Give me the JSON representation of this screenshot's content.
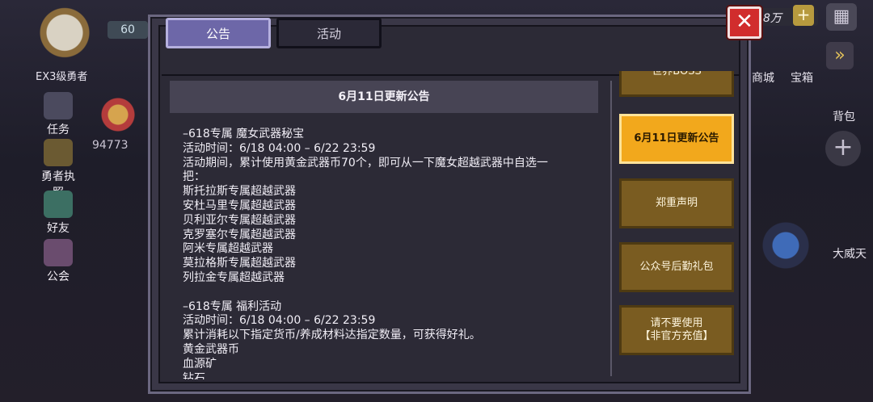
{
  "hud": {
    "level": "60",
    "rank_title": "EX3级勇者",
    "power": "94773",
    "currency": "8万",
    "side_buttons": [
      "任务",
      "勇者执照",
      "好友",
      "公会"
    ],
    "top_right_labels": [
      "商城",
      "宝箱",
      "背包"
    ],
    "boss_label": "大威天"
  },
  "dialog": {
    "tabs": [
      "公告",
      "活动"
    ],
    "active_tab_index": 0,
    "notice": {
      "title": "6月11日更新公告",
      "lines": [
        "–618专属 魔女武器秘宝",
        "活动时间：6/18 04:00 – 6/22 23:59",
        "活动期间，累计使用黄金武器币70个，即可从一下魔女超越武器中自选一",
        "把：",
        "斯托拉斯专属超越武器",
        "安杜马里专属超越武器",
        "贝利亚尔专属超越武器",
        "克罗塞尔专属超越武器",
        "阿米专属超越武器",
        "莫拉格斯专属超越武器",
        "列拉金专属超越武器",
        "",
        "–618专属 福利活动",
        "活动时间：6/18 04:00 – 6/22 23:59",
        "累计消耗以下指定货币/养成材料达指定数量，可获得好礼。",
        "黄金武器币",
        "血源矿",
        "钻石"
      ]
    },
    "side_list": [
      {
        "label": "世界BOSS",
        "active": false
      },
      {
        "label": "6月11日更新公告",
        "active": true
      },
      {
        "label": "郑重声明",
        "active": false
      },
      {
        "label": "公众号后勤礼包",
        "active": false
      },
      {
        "label": "请不要使用\n【非官方充值】",
        "active": false
      }
    ]
  },
  "icons": {
    "close": "close-icon",
    "plus": "plus-icon",
    "settings": "grid-icon",
    "arrow": "chevron-right-icon"
  },
  "colors": {
    "active_tab": "#6d67a8",
    "active_list_item": "#f2a81c",
    "list_item": "#7a5c21",
    "close_button": "#d12d2d"
  }
}
